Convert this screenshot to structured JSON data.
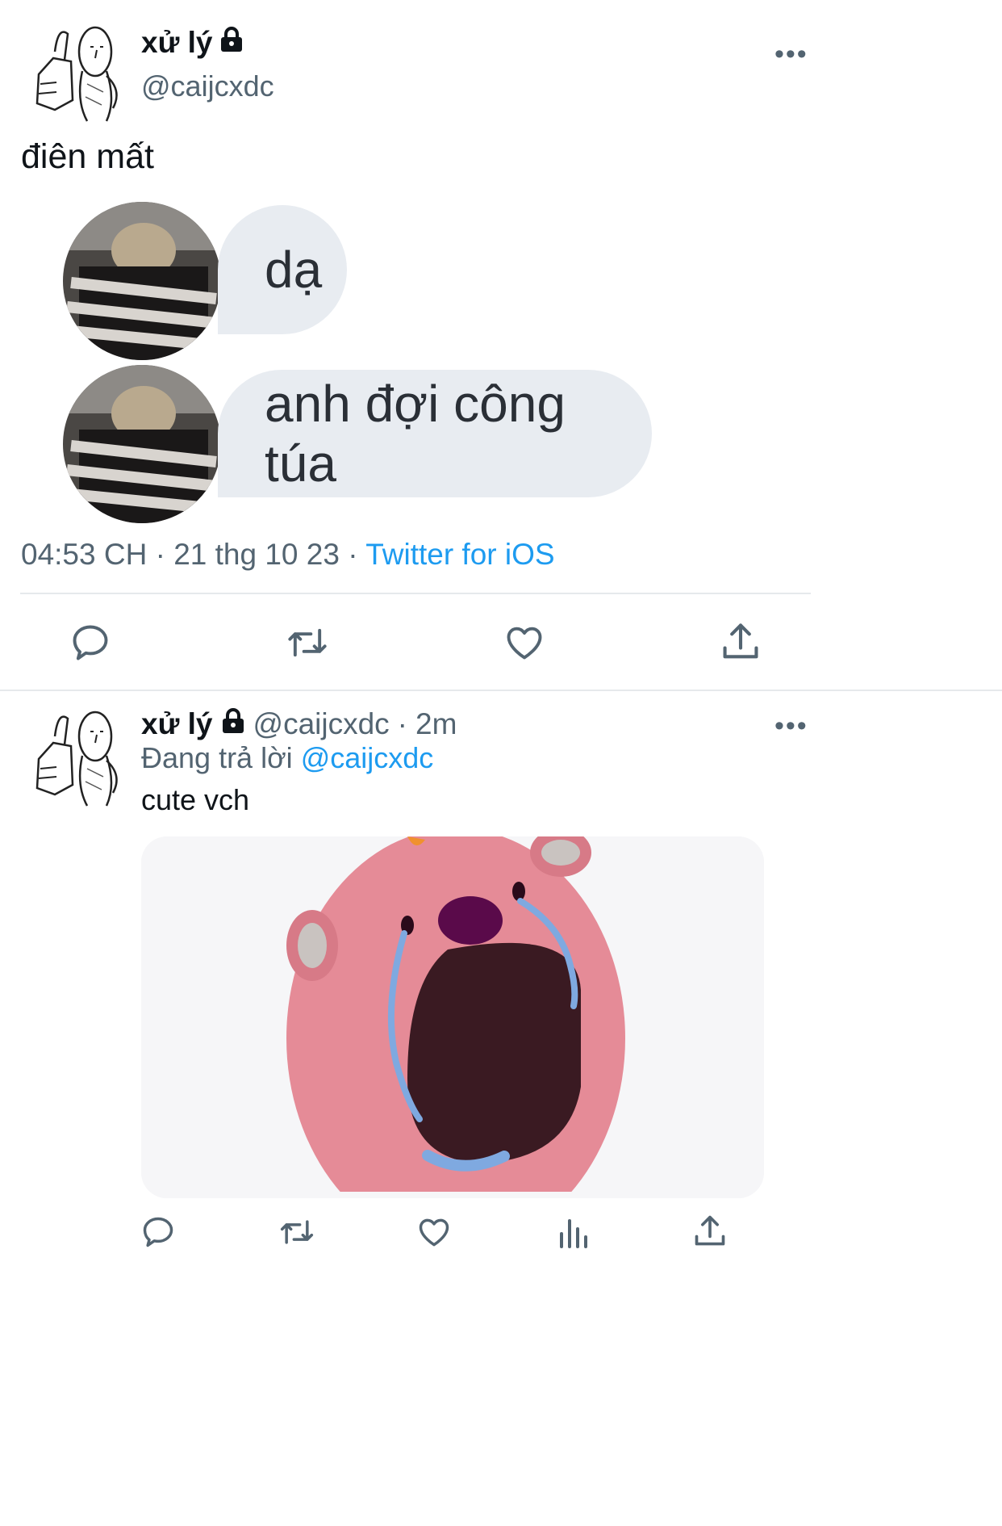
{
  "main_tweet": {
    "author_name": "xử lý",
    "handle": "@caijcxdc",
    "more_label": "•••",
    "text": "điên mất",
    "chat_bubbles": [
      "dạ",
      "anh đợi công túa"
    ],
    "meta": {
      "time": "04:53 CH",
      "sep1": "·",
      "date": "21 thg 10 23",
      "sep2": "·",
      "source": "Twitter for iOS"
    },
    "actions": [
      "reply-icon",
      "retweet-icon",
      "like-icon",
      "share-icon"
    ]
  },
  "reply_tweet": {
    "author_name": "xử lý",
    "handle": "@caijcxdc",
    "dot": "·",
    "time_ago": "2m",
    "more_label": "•••",
    "replying_prefix": "Đang trả lời",
    "replying_handle": "@caijcxdc",
    "text": "cute vch",
    "actions": [
      "reply-icon",
      "retweet-icon",
      "like-icon",
      "analytics-icon",
      "share-icon"
    ]
  },
  "colors": {
    "link": "#1d9bf0",
    "secondary_text": "#536471",
    "bubble_bg": "#e8ecf1",
    "media_pink": "#e58b97"
  }
}
